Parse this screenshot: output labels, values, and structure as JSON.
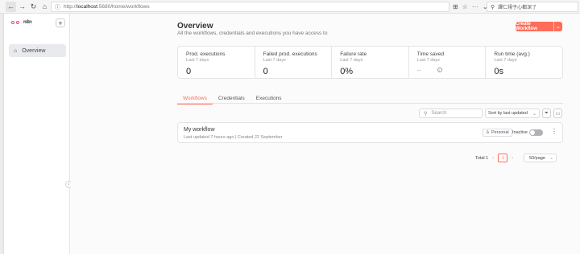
{
  "browser": {
    "url_host": "localhost",
    "url_rest": ":5680/home/workflows",
    "url_prefix": "http://",
    "search_text": "譯仁視子心都深了"
  },
  "sidebar": {
    "logo_text": "n8n",
    "add_label": "+",
    "items": [
      {
        "label": "Overview",
        "icon": "home-icon"
      }
    ],
    "collapse_label": "‹"
  },
  "header": {
    "title": "Overview",
    "subtitle": "All the workflows, credentials and executions you have access to",
    "create_label": "Create Workflow",
    "create_split": "⌄"
  },
  "stats": [
    {
      "label": "Prod. executions",
      "period": "Last 7 days",
      "value": "0"
    },
    {
      "label": "Failed prod. executions",
      "period": "Last 7 days",
      "value": "0"
    },
    {
      "label": "Failure rate",
      "period": "Last 7 days",
      "value": "0%"
    },
    {
      "label": "Time saved",
      "period": "Last 7 days",
      "value": "--"
    },
    {
      "label": "Run time (avg.)",
      "period": "Last 7 days",
      "value": "0s"
    }
  ],
  "tabs": [
    "Workflows",
    "Credentials",
    "Executions"
  ],
  "toolbar": {
    "search_placeholder": "Search",
    "sort_value": "Sort by last updated"
  },
  "workflows": [
    {
      "name": "My workflow",
      "meta": "Last updated 7 hours ago | Created 22 September",
      "badge": "Personal",
      "status": "Inactive"
    }
  ],
  "pagination": {
    "total_label": "Total 1",
    "current_page": "1",
    "page_size": "50/page"
  },
  "colors": {
    "accent": "#ff6d5a",
    "brand": "#ea4b71"
  }
}
